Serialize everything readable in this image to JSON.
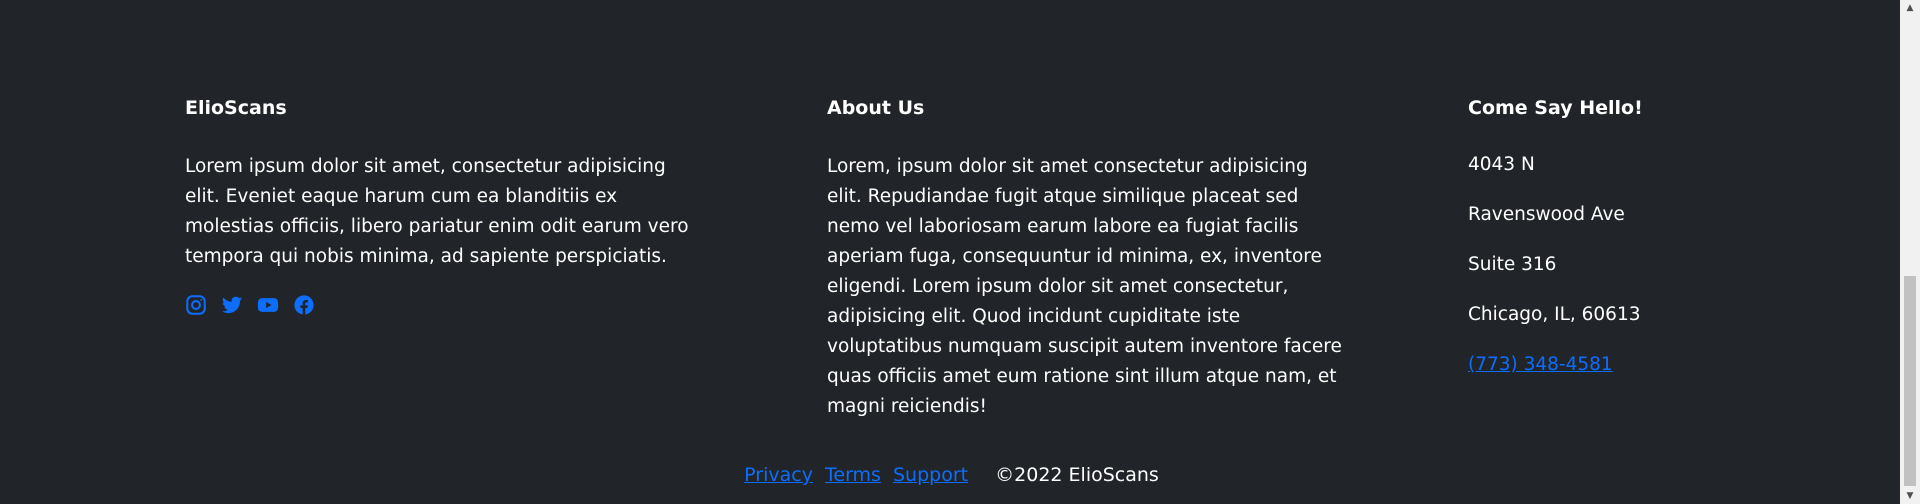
{
  "brand": {
    "title": "ElioScans",
    "text": "Lorem ipsum dolor sit amet, consectetur adipisicing elit. Eveniet eaque harum cum ea blanditiis ex molestias officiis, libero pariatur enim odit earum vero tempora qui nobis minima, ad sapiente perspiciatis."
  },
  "social": {
    "color": "#0d6efd",
    "icons": [
      "instagram-icon",
      "twitter-icon",
      "youtube-icon",
      "facebook-icon"
    ]
  },
  "about": {
    "title": "About Us",
    "text": "Lorem, ipsum dolor sit amet consectetur adipisicing elit. Repudiandae fugit atque similique placeat sed nemo vel laboriosam earum labore ea fugiat facilis aperiam fuga, consequuntur id minima, ex, inventore eligendi. Lorem ipsum dolor sit amet consectetur, adipisicing elit. Quod incidunt cupiditate iste voluptatibus numquam suscipit autem inventore facere quas officiis amet eum ratione sint illum atque nam, et magni reiciendis!"
  },
  "contact": {
    "title": "Come Say Hello!",
    "address": [
      "4043 N",
      "Ravenswood Ave",
      "Suite 316",
      "Chicago, IL, 60613"
    ],
    "phone": "(773) 348-4581"
  },
  "bottom": {
    "links": [
      "Privacy",
      "Terms",
      "Support"
    ],
    "copyright": "©2022 ElioScans"
  },
  "colors": {
    "background": "#212529",
    "link": "#0d6efd",
    "text": "#ffffff"
  }
}
